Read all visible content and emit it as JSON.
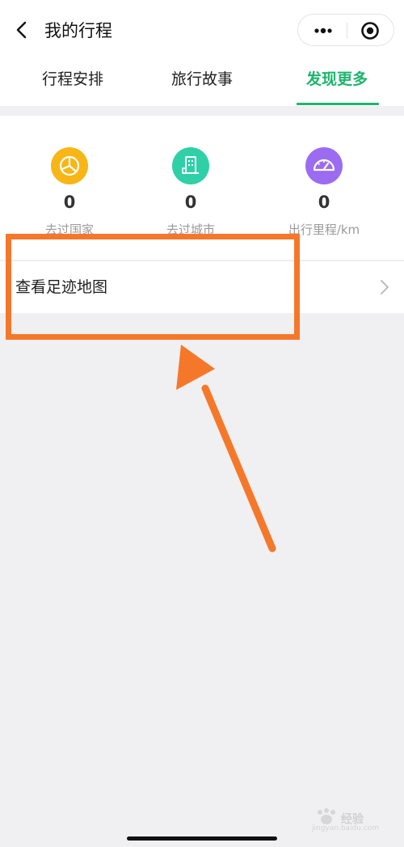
{
  "header": {
    "title": "我的行程",
    "capsule": {
      "more_icon": "more-dots-icon",
      "close_icon": "target-circle-icon"
    }
  },
  "tabs": [
    {
      "label": "行程安排",
      "active": false
    },
    {
      "label": "旅行故事",
      "active": false
    },
    {
      "label": "发现更多",
      "active": true
    }
  ],
  "stats": [
    {
      "value": "0",
      "label": "去过国家",
      "icon": "pie-chart-icon",
      "color": "#f8b616"
    },
    {
      "value": "0",
      "label": "去过城市",
      "icon": "building-icon",
      "color": "#2fd0a8"
    },
    {
      "value": "0",
      "label": "出行里程/km",
      "icon": "speedometer-icon",
      "color": "#9b6cf2"
    }
  ],
  "footprint": {
    "label": "查看足迹地图",
    "chevron_icon": "chevron-right-icon"
  },
  "annotation": {
    "color": "#f5782a"
  },
  "colors": {
    "accent": "#1fb46e",
    "background": "#f0eff2"
  },
  "watermark": {
    "text": "经验",
    "sub": "jingyan.baidu.com"
  }
}
